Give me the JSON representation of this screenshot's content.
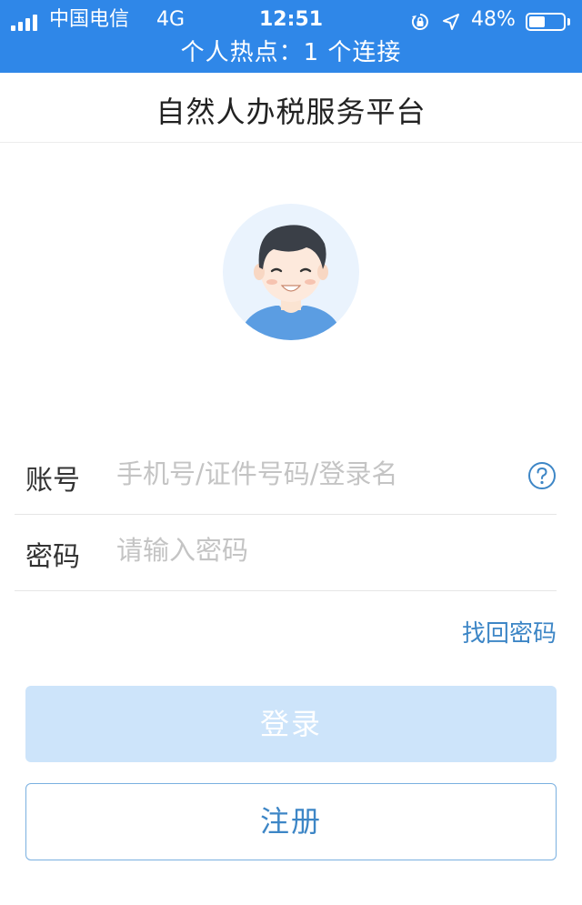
{
  "status_bar": {
    "carrier": "中国电信",
    "network": "4G",
    "time": "12:51",
    "battery_percent": "48%",
    "battery_level": 0.48,
    "hotspot": "个人热点：1 个连接",
    "icons": [
      "signal-icon",
      "rotation-lock-icon",
      "location-arrow-icon",
      "battery-icon"
    ]
  },
  "header": {
    "title": "自然人办税服务平台"
  },
  "form": {
    "account_label": "账号",
    "account_placeholder": "手机号/证件号码/登录名",
    "password_label": "密码",
    "password_placeholder": "请输入密码",
    "forgot_label": "找回密码"
  },
  "actions": {
    "login_label": "登录",
    "register_label": "注册"
  },
  "colors": {
    "status_bar": "#2f87e8",
    "accent": "#3d86c6",
    "login_disabled": "#cde4fa"
  }
}
